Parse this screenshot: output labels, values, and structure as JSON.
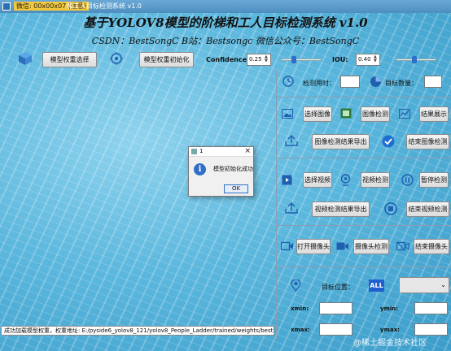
{
  "titlebar": {
    "tag": "微信: 00x00x07 (注意)",
    "title": "和工人目标检测系统 v1.0"
  },
  "header": {
    "title": "基于YOLOV8模型的阶梯和工人目标检测系统 v1.0",
    "subtitle": "CSDN：BestSongC   B站：Bestsongc   微信公众号：BestSongC"
  },
  "toolbar": {
    "select_weights": "模型权重选择",
    "init_weights": "模型权重初始化",
    "confidence_label": "Confidence:",
    "confidence_value": "0.25",
    "confidence_level": 0.25,
    "iou_label": "IOU:",
    "iou_value": "0.40",
    "iou_level": 0.4
  },
  "panel": {
    "time_label": "检测用时：",
    "count_label": "目标数量：",
    "select_image": "选择图像",
    "image_detect": "图像检测",
    "result_show": "结果展示",
    "export_image_result": "图像检测结果导出",
    "end_image_detect": "结束图像检测",
    "select_video": "选择视频",
    "video_detect": "视频检测",
    "pause_detect": "暂停检测",
    "export_video_result": "视频检测结果导出",
    "end_video_detect": "结束视频检测",
    "open_camera": "打开摄像头",
    "camera_detect": "摄像头检测",
    "close_camera": "结束摄像头",
    "target_position": "目标位置：",
    "all_label": "ALL",
    "xmin": "xmin:",
    "ymin": "ymin:",
    "xmax": "xmax:",
    "ymax": "ymax:"
  },
  "dialog": {
    "title": "1",
    "message": "模型初始化成功",
    "ok": "OK"
  },
  "status": "成功加载模型权重，权重地址: E:/pyside6_yolov8_121/yolov8_People_Ladder/trained/weights/best.pt",
  "watermark": "@稀土掘金技术社区",
  "colors": {
    "accent": "#2f6fc8",
    "background": "#5bb7dd"
  }
}
